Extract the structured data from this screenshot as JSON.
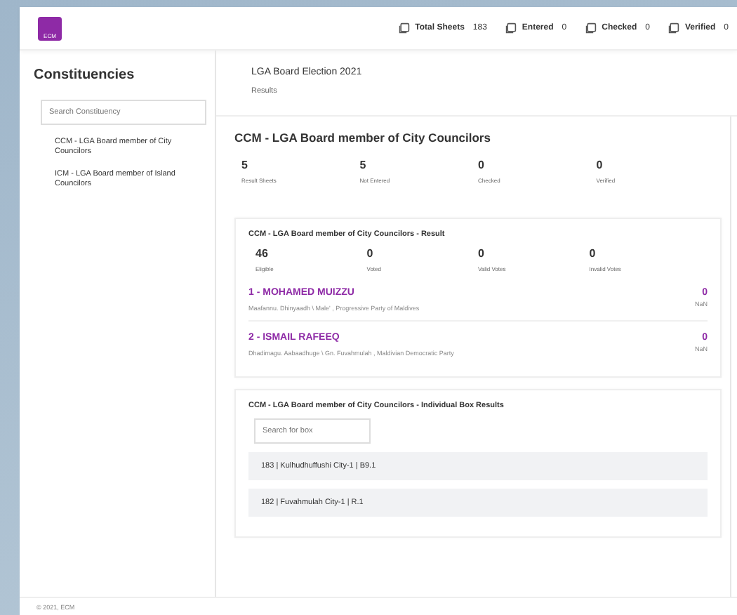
{
  "header": {
    "logo": "ECM",
    "stats": [
      {
        "label": "Total Sheets",
        "value": "183"
      },
      {
        "label": "Entered",
        "value": "0"
      },
      {
        "label": "Checked",
        "value": "0"
      },
      {
        "label": "Verified",
        "value": "0"
      }
    ]
  },
  "sidebar": {
    "title": "Constituencies",
    "search": {
      "placeholder": "Search Constituency"
    },
    "items": [
      {
        "label": "CCM - LGA Board member of City Councilors"
      },
      {
        "label": "ICM - LGA Board member of Island Councilors"
      }
    ]
  },
  "page": {
    "title": "LGA Board Election 2021",
    "subtitle": "Results"
  },
  "section": {
    "title": "CCM - LGA Board member of City Councilors",
    "stats": [
      {
        "value": "5",
        "label": "Result Sheets"
      },
      {
        "value": "5",
        "label": "Not Entered"
      },
      {
        "value": "0",
        "label": "Checked"
      },
      {
        "value": "0",
        "label": "Verified"
      }
    ]
  },
  "result": {
    "title": "CCM - LGA Board member of City Councilors - Result",
    "stats": [
      {
        "value": "46",
        "label": "Eligible"
      },
      {
        "value": "0",
        "label": "Voted"
      },
      {
        "value": "0",
        "label": "Valid Votes"
      },
      {
        "value": "0",
        "label": "Invalid Votes"
      }
    ],
    "candidates": [
      {
        "name": "1 - MOHAMED MUIZZU",
        "detail": "Maafannu. Dhinyaadh \\ Male' , Progressive Party of Maldives",
        "votes": "0",
        "share": "NaN"
      },
      {
        "name": "2 - ISMAIL RAFEEQ",
        "detail": "Dhadimagu. Aabaadhuge \\ Gn. Fuvahmulah , Maldivian Democratic Party",
        "votes": "0",
        "share": "NaN"
      }
    ]
  },
  "boxes": {
    "title": "CCM - LGA Board member of City Councilors - Individual Box Results",
    "search": {
      "placeholder": "Search for box"
    },
    "rows": [
      {
        "label": "183 | Kulhudhuffushi City-1 | B9.1"
      },
      {
        "label": "182 | Fuvahmulah City-1 | R.1"
      }
    ]
  },
  "footer": "© 2021, ECM"
}
